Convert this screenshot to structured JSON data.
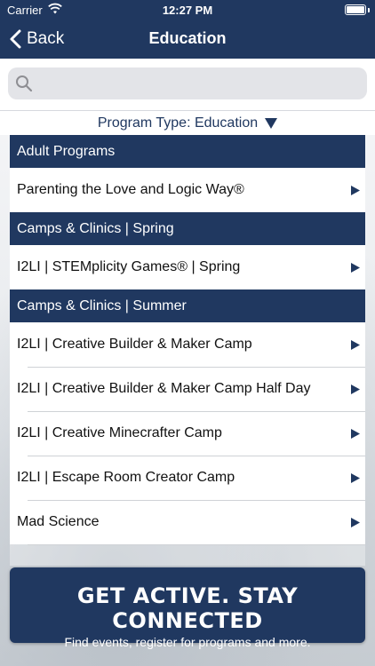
{
  "status_bar": {
    "carrier": "Carrier",
    "time": "12:27 PM"
  },
  "nav": {
    "back_label": "Back",
    "title": "Education"
  },
  "search": {
    "placeholder": ""
  },
  "filter": {
    "label": "Program Type: Education"
  },
  "sections": [
    {
      "title": "Adult Programs",
      "items": [
        "Parenting the Love and Logic Way®"
      ]
    },
    {
      "title": "Camps & Clinics | Spring",
      "items": [
        "I2LI | STEMplicity Games® | Spring"
      ]
    },
    {
      "title": "Camps & Clinics | Summer",
      "items": [
        "I2LI | Creative Builder & Maker Camp",
        "I2LI | Creative Builder & Maker Camp Half Day",
        "I2LI | Creative Minecrafter Camp",
        "I2LI | Escape Room Creator Camp",
        "Mad Science"
      ]
    }
  ],
  "promo": {
    "headline": "GET ACTIVE.  STAY CONNECTED",
    "subtext": "Find events, register for programs and more."
  },
  "colors": {
    "brand_navy": "#203860",
    "row_bg": "#ffffff",
    "search_bg": "#e3e4e8"
  },
  "icons": {
    "back": "chevron-left-icon",
    "search": "search-icon",
    "filter": "triangle-down-icon",
    "row": "triangle-right-icon"
  }
}
